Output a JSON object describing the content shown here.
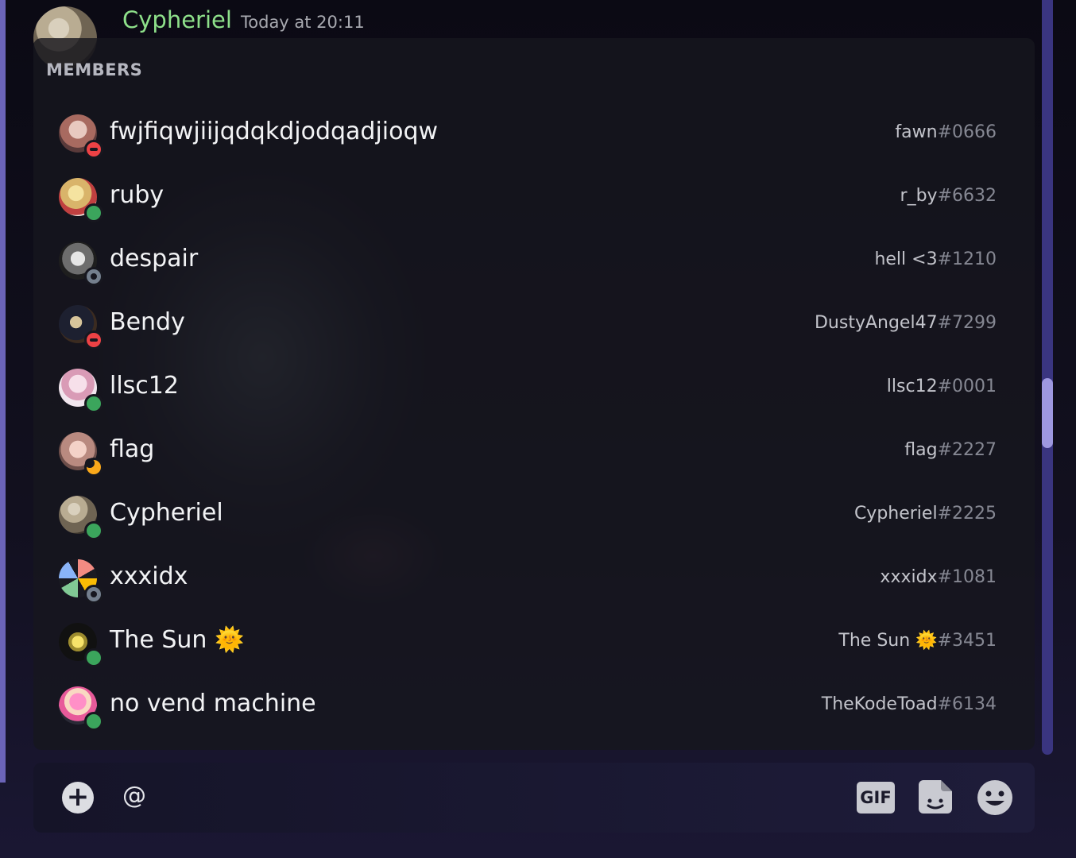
{
  "message": {
    "author": "Cypheriel",
    "timestamp": "Today at 20:11"
  },
  "members_popup": {
    "header": "MEMBERS",
    "members": [
      {
        "name": "fwjfiqwjiijqdqkdjodqadjioqw",
        "username": "fawn",
        "discriminator": "#0666",
        "status": "dnd"
      },
      {
        "name": "ruby",
        "username": "r_by",
        "discriminator": "#6632",
        "status": "online"
      },
      {
        "name": "despair",
        "username": "hell <3",
        "discriminator": "#1210",
        "status": "offline"
      },
      {
        "name": "Bendy",
        "username": "DustyAngel47",
        "discriminator": "#7299",
        "status": "dnd"
      },
      {
        "name": "llsc12",
        "username": "llsc12",
        "discriminator": "#0001",
        "status": "online"
      },
      {
        "name": "flag",
        "username": "flag",
        "discriminator": "#2227",
        "status": "idle"
      },
      {
        "name": "Cypheriel",
        "username": "Cypheriel",
        "discriminator": "#2225",
        "status": "online"
      },
      {
        "name": "xxxidx",
        "username": "xxxidx",
        "discriminator": "#1081",
        "status": "offline"
      },
      {
        "name": "The Sun 🌞",
        "username": "The Sun 🌞",
        "discriminator": "#3451",
        "status": "online"
      },
      {
        "name": "no vend machine",
        "username": "TheKodeToad",
        "discriminator": "#6134",
        "status": "online"
      }
    ]
  },
  "composer": {
    "input_value": "@",
    "gif_label": "GIF",
    "icons": [
      "plus-icon",
      "gif-icon",
      "sticker-icon",
      "emoji-icon"
    ]
  },
  "colors": {
    "online": "#3ba55c",
    "dnd": "#ed4245",
    "idle": "#faa81a",
    "offline": "#747f8d",
    "author_name": "#8ee08a",
    "scrollbar": "#9e98e0"
  }
}
